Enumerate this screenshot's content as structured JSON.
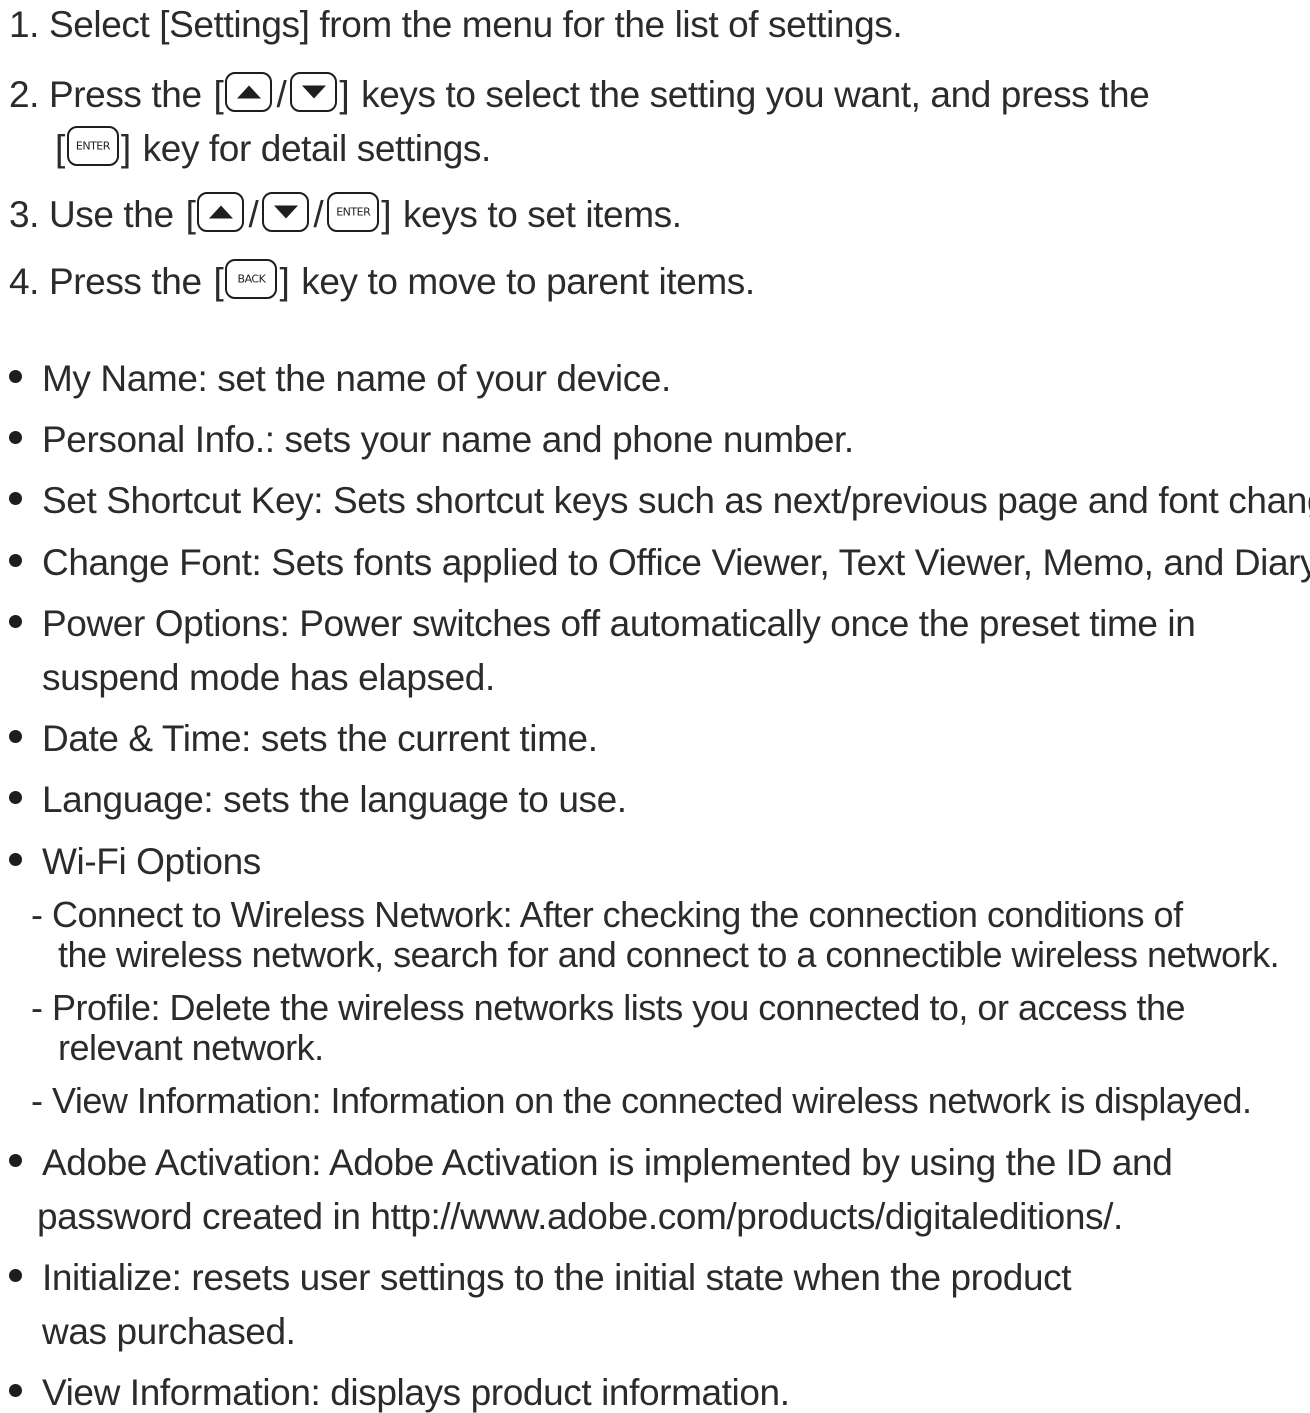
{
  "steps": [
    {
      "num": "1.",
      "text": "Select [Settings] from the menu for the list of settings."
    },
    {
      "num": "2.",
      "pre": "Press the",
      "post": "keys to select the setting you want, and press the",
      "cont_post": "key for detail settings."
    },
    {
      "num": "3.",
      "pre": "Use the",
      "post": "keys to set items."
    },
    {
      "num": "4.",
      "pre": "Press the",
      "post": "key to move to parent items."
    }
  ],
  "keys": {
    "enter_label": "ENTER",
    "back_label": "BACK",
    "up_icon": "up-arrow-key-icon",
    "down_icon": "down-arrow-key-icon"
  },
  "bullets": [
    {
      "lines": [
        "My Name: set the name of your device."
      ]
    },
    {
      "lines": [
        "Personal Info.: sets your name and phone number."
      ]
    },
    {
      "lines": [
        "Set Shortcut Key: Sets shortcut keys such as next/previous page and font change"
      ]
    },
    {
      "lines": [
        "Change Font: Sets fonts applied to Office Viewer, Text Viewer, Memo, and Diary."
      ]
    },
    {
      "lines": [
        "Power Options: Power switches off automatically once the preset time in",
        "suspend mode has elapsed."
      ]
    },
    {
      "lines": [
        "Date & Time: sets the current time."
      ]
    },
    {
      "lines": [
        "Language: sets the language to use."
      ]
    },
    {
      "lines": [
        "Wi-Fi Options"
      ],
      "subitems": [
        {
          "lines": [
            "- Connect to Wireless Network: After checking the connection conditions of",
            "the wireless network, search for and connect to a connectible wireless network."
          ]
        },
        {
          "lines": [
            "- Profile: Delete the wireless networks lists you connected to, or access the",
            "relevant network."
          ]
        },
        {
          "lines": [
            "- View Information: Information on the connected wireless network is displayed."
          ]
        }
      ]
    },
    {
      "lines": [
        "Adobe Activation: Adobe Activation is implemented by using the ID and",
        "password created in http://www.adobe.com/products/digitaleditions/."
      ]
    },
    {
      "lines": [
        "Initialize: resets user settings to the initial state when the product",
        "was purchased."
      ]
    },
    {
      "lines": [
        "View Information: displays product information."
      ]
    }
  ]
}
